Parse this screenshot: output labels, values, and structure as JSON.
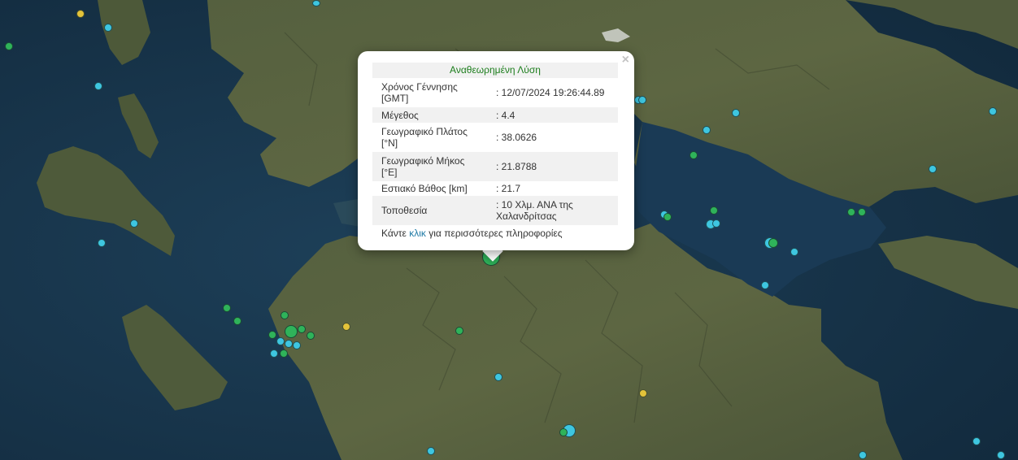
{
  "popup": {
    "title": "Αναθεωρημένη Λύση",
    "close_label": "×",
    "rows": [
      {
        "label": "Χρόνος Γέννησης [GMT]",
        "value": ": 12/07/2024 19:26:44.89"
      },
      {
        "label": "Μέγεθος",
        "value": ": 4.4"
      },
      {
        "label": "Γεωγραφικό Πλάτος [°N]",
        "value": ": 38.0626"
      },
      {
        "label": "Γεωγραφικό Μήκος [°E]",
        "value": ": 21.8788"
      },
      {
        "label": "Εστιακό Βάθος [km]",
        "value": ": 21.7"
      },
      {
        "label": "Τοποθεσία",
        "value": ": 10 Χλμ. ΑΝΑ της Χαλανδρίτσας"
      }
    ],
    "more_prefix": "Κάντε",
    "more_link": "κλικ",
    "more_suffix": "για περισσότερες πληροφορίες"
  },
  "colors": {
    "cyan": "#3ec6e0",
    "green": "#2fb35a",
    "yellow": "#e3c33a",
    "sea": "#17344a",
    "land": "#4f5a3c"
  }
}
